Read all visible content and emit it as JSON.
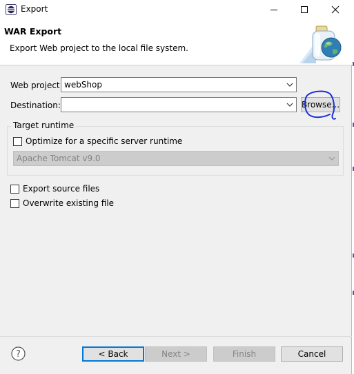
{
  "window": {
    "title": "Export",
    "controls": {
      "minimize": "minimize-icon",
      "maximize": "maximize-icon",
      "close": "close-icon"
    }
  },
  "header": {
    "title": "WAR Export",
    "description": "Export Web project to the local file system.",
    "graphic": "export-jar-globe-icon"
  },
  "form": {
    "web_project_label": "Web project:",
    "web_project_value": "webShop",
    "destination_label": "Destination:",
    "destination_value": "",
    "browse_label": "Browse..."
  },
  "target_runtime": {
    "group_label": "Target runtime",
    "optimize_label": "Optimize for a specific server runtime",
    "optimize_checked": false,
    "runtime_value": "Apache Tomcat v9.0"
  },
  "options": {
    "export_source_label": "Export source files",
    "export_source_checked": false,
    "overwrite_label": "Overwrite existing file",
    "overwrite_checked": false
  },
  "footer": {
    "help_icon": "help-icon",
    "back_label": "< Back",
    "next_label": "Next >",
    "finish_label": "Finish",
    "cancel_label": "Cancel"
  },
  "colors": {
    "accent": "#0078d7",
    "dialog_bg": "#f0f0f0",
    "annotation": "#1a2fd6"
  }
}
